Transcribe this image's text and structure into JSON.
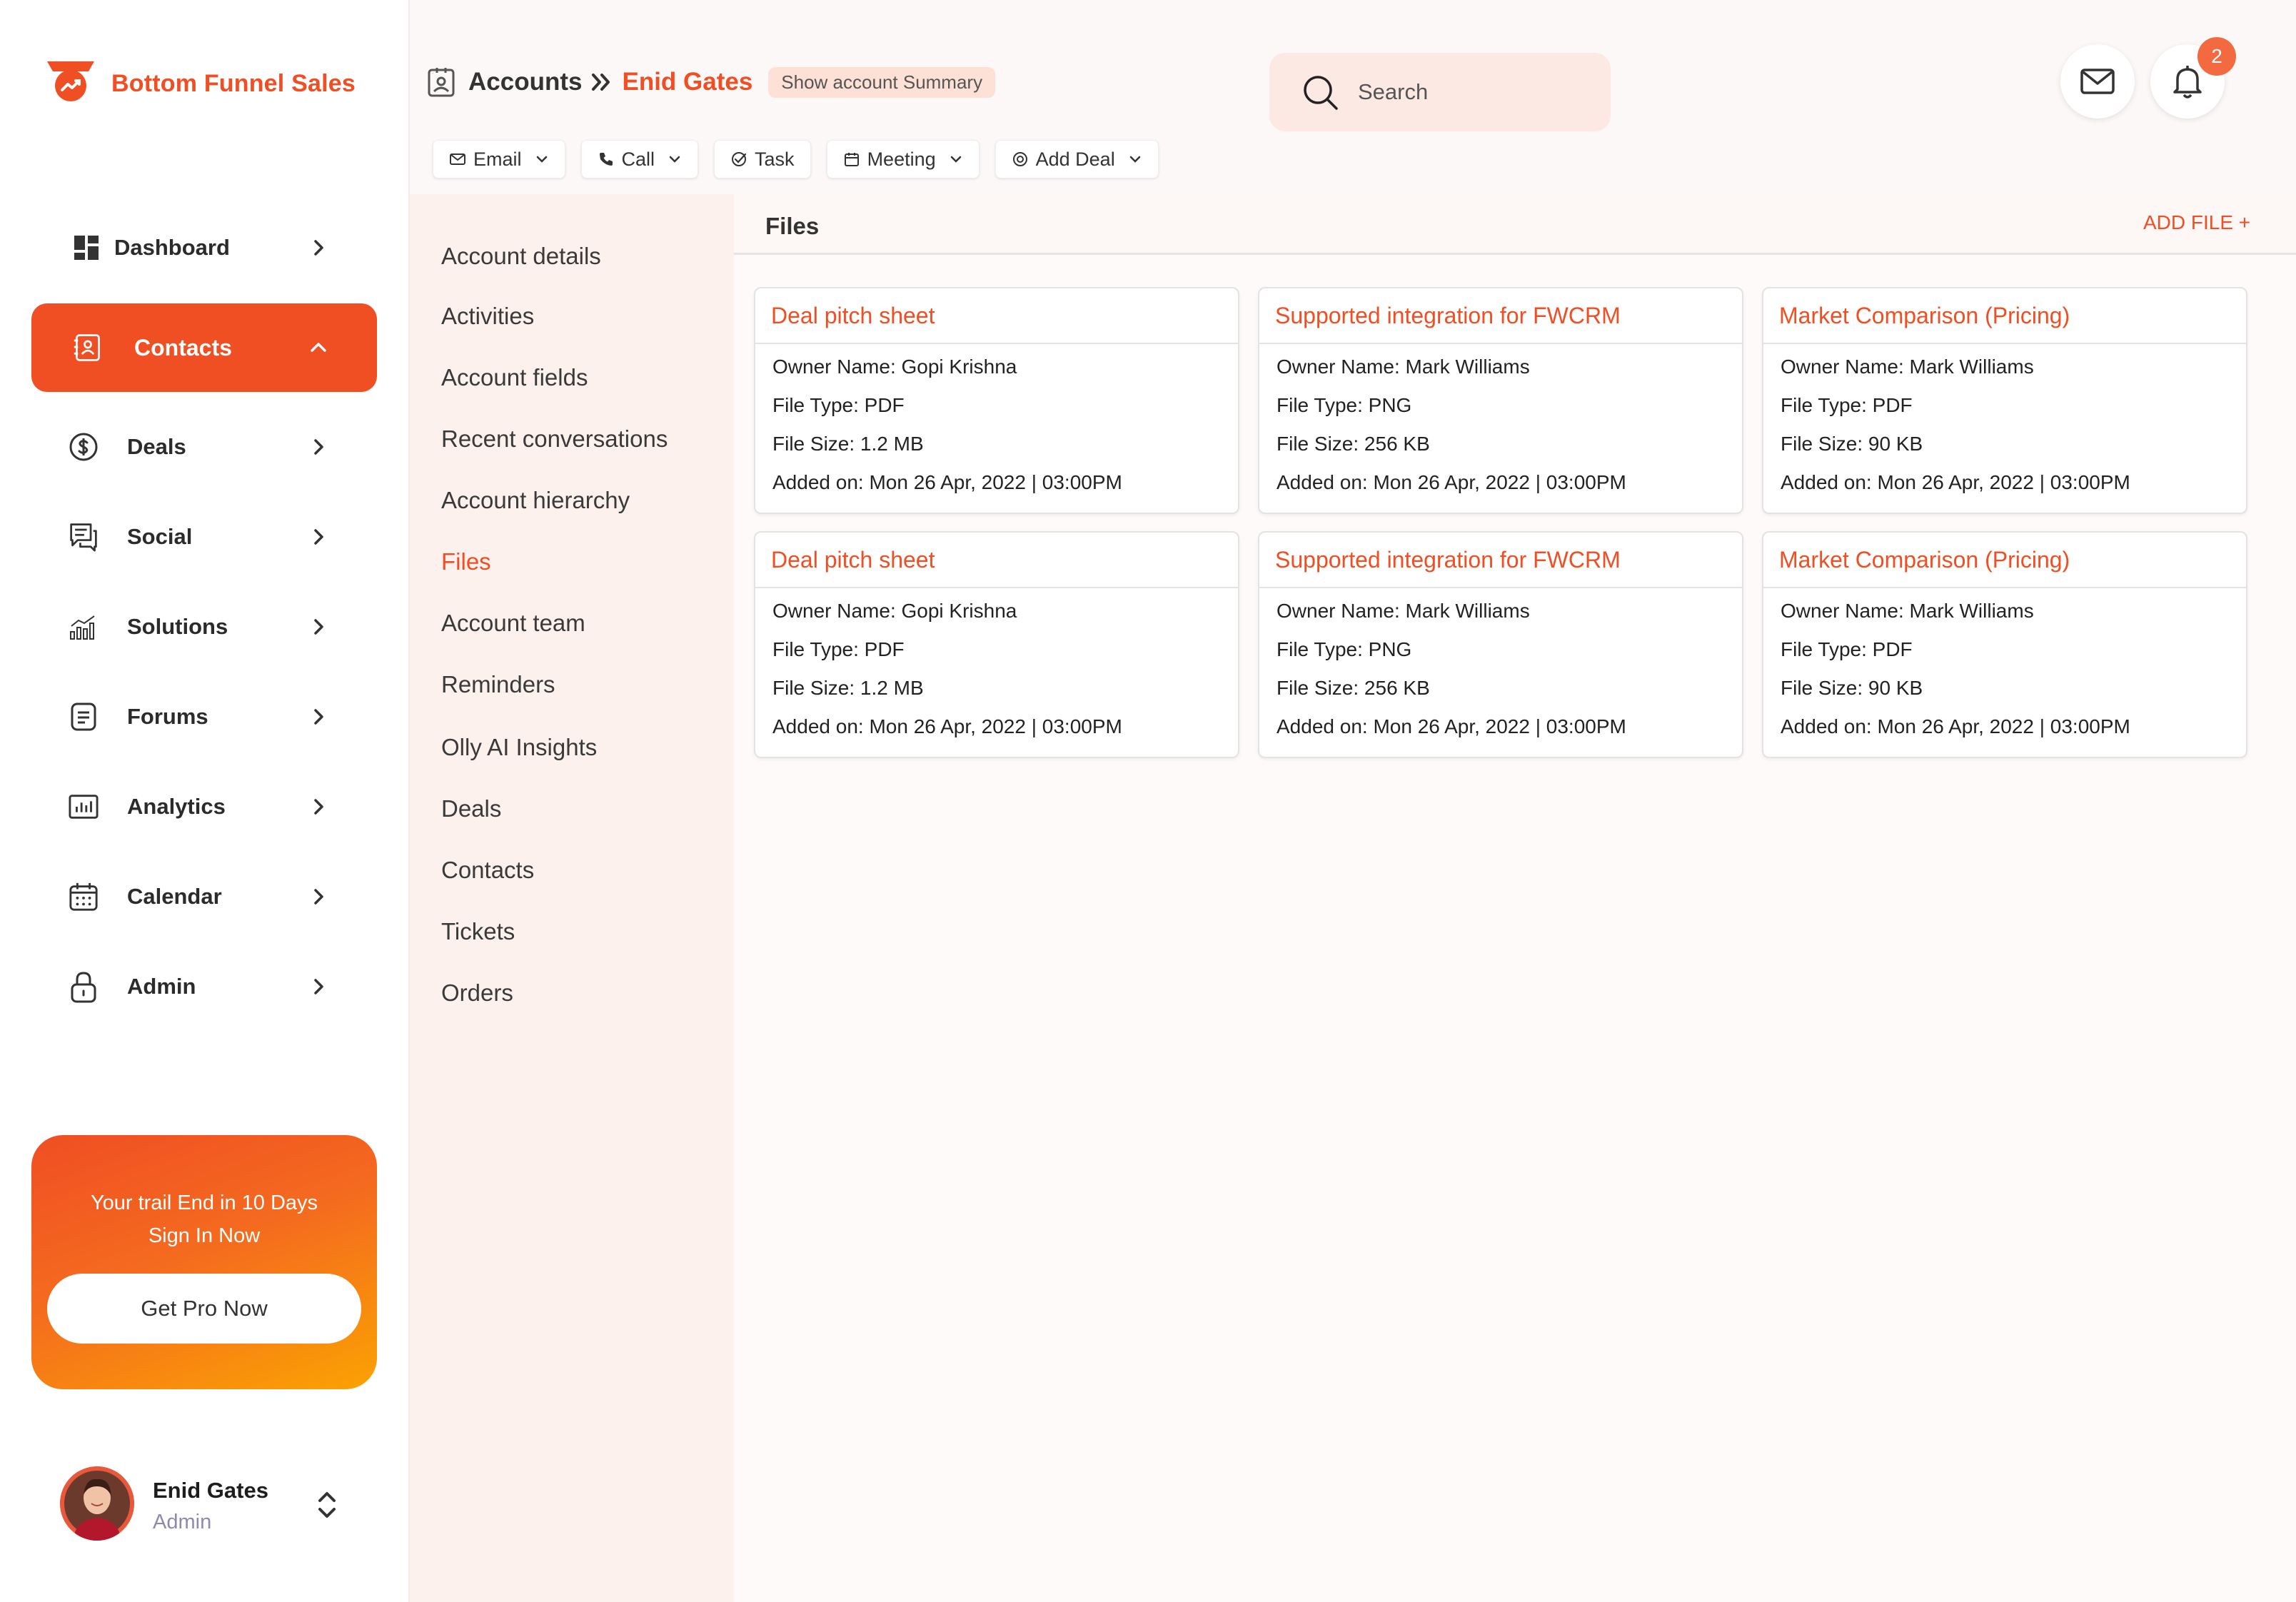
{
  "brand": {
    "name": "Bottom Funnel Sales",
    "color": "#f04e23"
  },
  "sidebar": {
    "items": [
      {
        "label": "Dashboard",
        "icon": "dashboard-icon"
      },
      {
        "label": "Contacts",
        "icon": "contacts-icon",
        "active": true
      },
      {
        "label": "Deals",
        "icon": "dollar-icon"
      },
      {
        "label": "Social",
        "icon": "chat-icon"
      },
      {
        "label": "Solutions",
        "icon": "bar-chart-icon"
      },
      {
        "label": "Forums",
        "icon": "document-icon"
      },
      {
        "label": "Analytics",
        "icon": "analytics-icon"
      },
      {
        "label": "Calendar",
        "icon": "calendar-icon"
      },
      {
        "label": "Admin",
        "icon": "lock-icon"
      }
    ]
  },
  "promo": {
    "line1": "Your trail End in 10 Days",
    "line2": "Sign In Now",
    "button": "Get Pro Now"
  },
  "profile": {
    "name": "Enid Gates",
    "role": "Admin"
  },
  "header": {
    "breadcrumb_root": "Accounts",
    "breadcrumb_current": "Enid Gates",
    "summary_button": "Show account Summary",
    "search_placeholder": "Search",
    "notification_count": "2"
  },
  "actions": [
    {
      "label": "Email",
      "icon": "mail-icon",
      "dropdown": true
    },
    {
      "label": "Call",
      "icon": "phone-icon",
      "dropdown": true
    },
    {
      "label": "Task",
      "icon": "check-circle-icon",
      "dropdown": false
    },
    {
      "label": "Meeting",
      "icon": "calendar-icon",
      "dropdown": true
    },
    {
      "label": "Add Deal",
      "icon": "dollar-icon",
      "dropdown": true
    }
  ],
  "subnav": {
    "items": [
      "Account details",
      "Activities",
      "Account fields",
      "Recent conversations",
      "Account hierarchy",
      "Files",
      "Account team",
      "Reminders",
      "Olly AI Insights",
      "Deals",
      "Contacts",
      "Tickets",
      "Orders"
    ],
    "active": "Files"
  },
  "files": {
    "title": "Files",
    "add_label": "ADD FILE +",
    "cards": [
      {
        "title": "Deal pitch sheet",
        "owner": "Owner Name: Gopi Krishna",
        "type": "File Type: PDF",
        "size": "File Size: 1.2 MB",
        "added": "Added on: Mon 26 Apr, 2022 | 03:00PM"
      },
      {
        "title": "Supported integration for FWCRM",
        "owner": "Owner Name: Mark Williams",
        "type": "File Type: PNG",
        "size": "File Size: 256 KB",
        "added": "Added on: Mon 26 Apr, 2022 | 03:00PM"
      },
      {
        "title": "Market Comparison (Pricing)",
        "owner": "Owner Name: Mark Williams",
        "type": "File Type: PDF",
        "size": "File Size: 90 KB",
        "added": "Added on: Mon 26 Apr, 2022 | 03:00PM"
      },
      {
        "title": "Deal pitch sheet",
        "owner": "Owner Name: Gopi Krishna",
        "type": "File Type: PDF",
        "size": "File Size: 1.2 MB",
        "added": "Added on: Mon 26 Apr, 2022 | 03:00PM"
      },
      {
        "title": "Supported integration for FWCRM",
        "owner": "Owner Name: Mark Williams",
        "type": "File Type: PNG",
        "size": "File Size: 256 KB",
        "added": "Added on: Mon 26 Apr, 2022 | 03:00PM"
      },
      {
        "title": "Market Comparison (Pricing)",
        "owner": "Owner Name: Mark Williams",
        "type": "File Type: PDF",
        "size": "File Size: 90 KB",
        "added": "Added on: Mon 26 Apr, 2022 | 03:00PM"
      }
    ]
  }
}
